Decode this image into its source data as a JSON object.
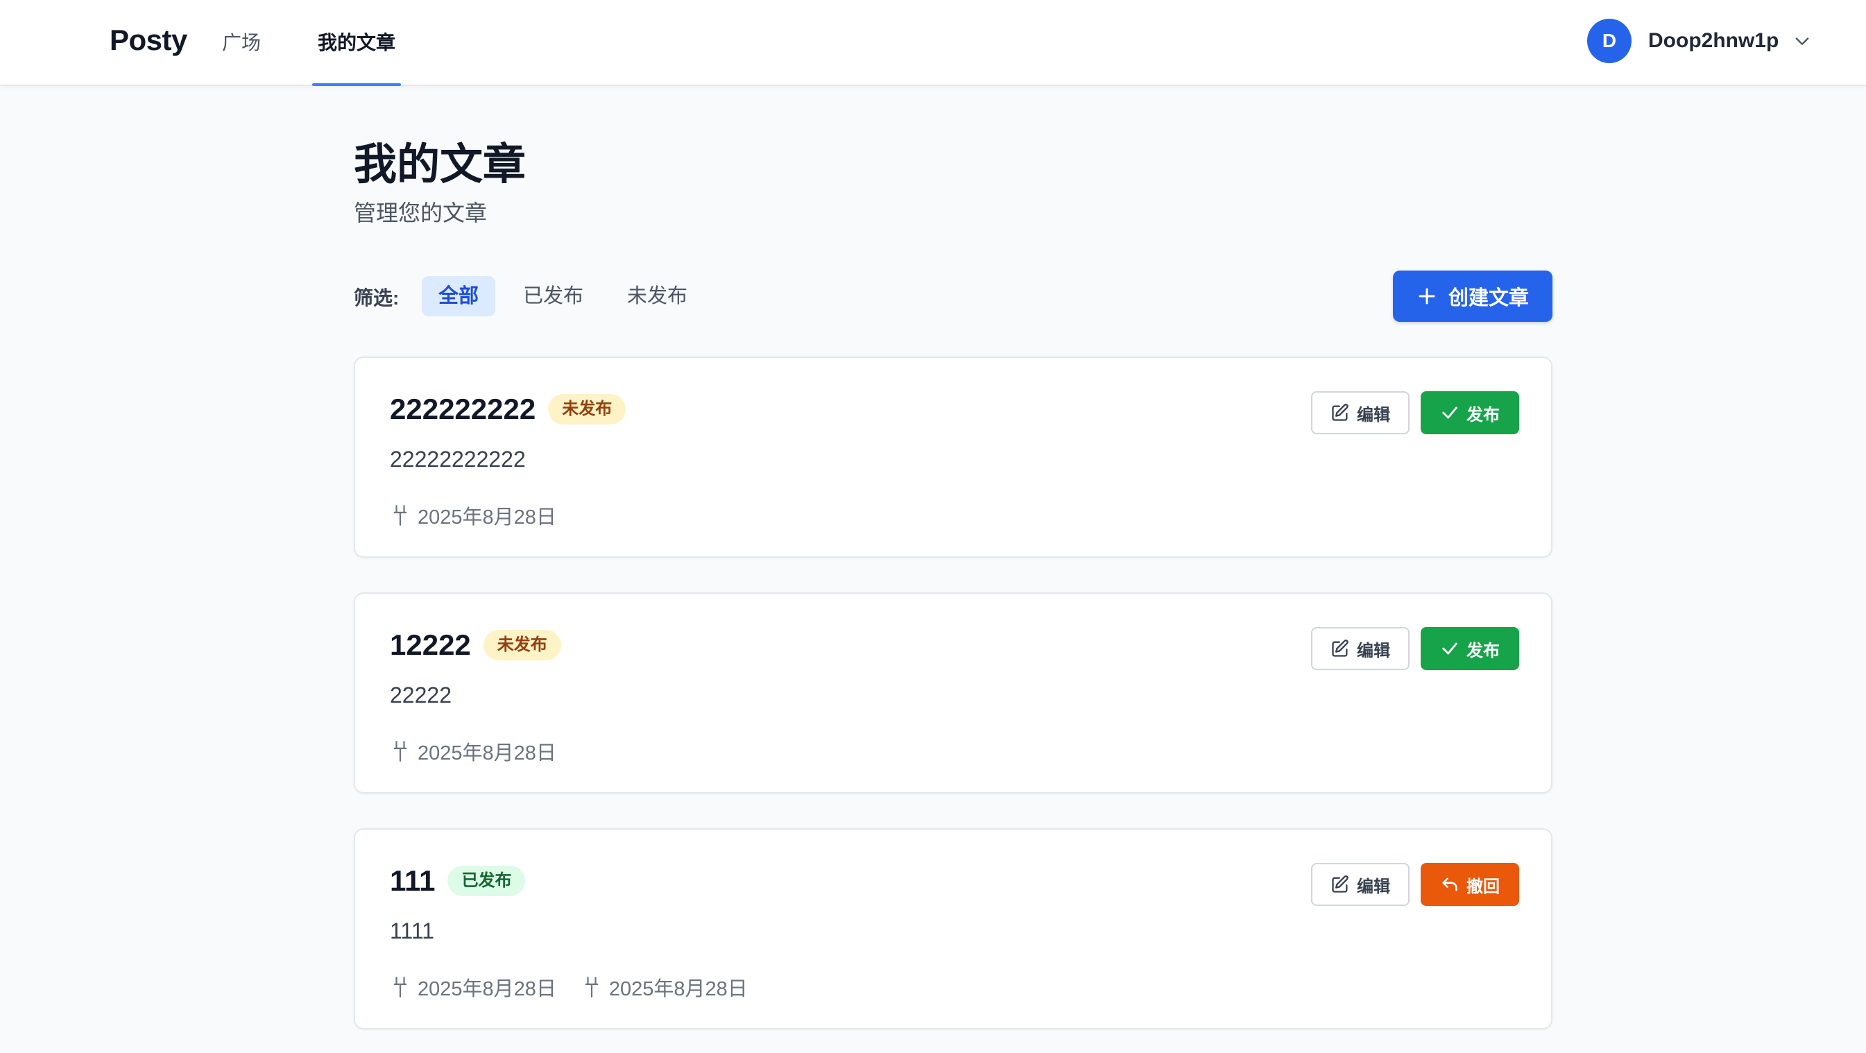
{
  "header": {
    "brand": "Posty",
    "nav": [
      {
        "label": "广场"
      },
      {
        "label": "我的文章"
      }
    ],
    "user": {
      "initial": "D",
      "name": "Doop2hnw1p"
    }
  },
  "page": {
    "title": "我的文章",
    "subtitle": "管理您的文章"
  },
  "filter": {
    "label": "筛选:",
    "options": [
      {
        "label": "全部",
        "selected": true
      },
      {
        "label": "已发布",
        "selected": false
      },
      {
        "label": "未发布",
        "selected": false
      }
    ]
  },
  "create_button": {
    "label": "创建文章"
  },
  "posts": [
    {
      "title": "222222222",
      "status": "未发布",
      "content": "22222222222",
      "dates": [
        "2025年8月28日"
      ],
      "edit_label": "编辑",
      "action_label": "发布"
    },
    {
      "title": "12222",
      "status": "未发布",
      "content": "22222",
      "dates": [
        "2025年8月28日"
      ],
      "edit_label": "编辑",
      "action_label": "发布"
    },
    {
      "title": "111",
      "status": "已发布",
      "content": "1111",
      "dates": [
        "2025年8月28日",
        "2025年8月28日"
      ],
      "edit_label": "编辑",
      "action_label": "撤回"
    }
  ],
  "colors": {
    "primary": "#2563eb",
    "publish": "#16a34a",
    "revoke": "#ea580c",
    "badge_unpublished_bg": "#fef3c7",
    "badge_published_bg": "#dcfce7"
  },
  "icons": {
    "create": "plus-icon",
    "edit": "pencil-square-icon",
    "publish": "check-icon",
    "revoke": "undo-arrow-icon",
    "date": "pin-icon",
    "user_menu": "chevron-down-icon"
  }
}
